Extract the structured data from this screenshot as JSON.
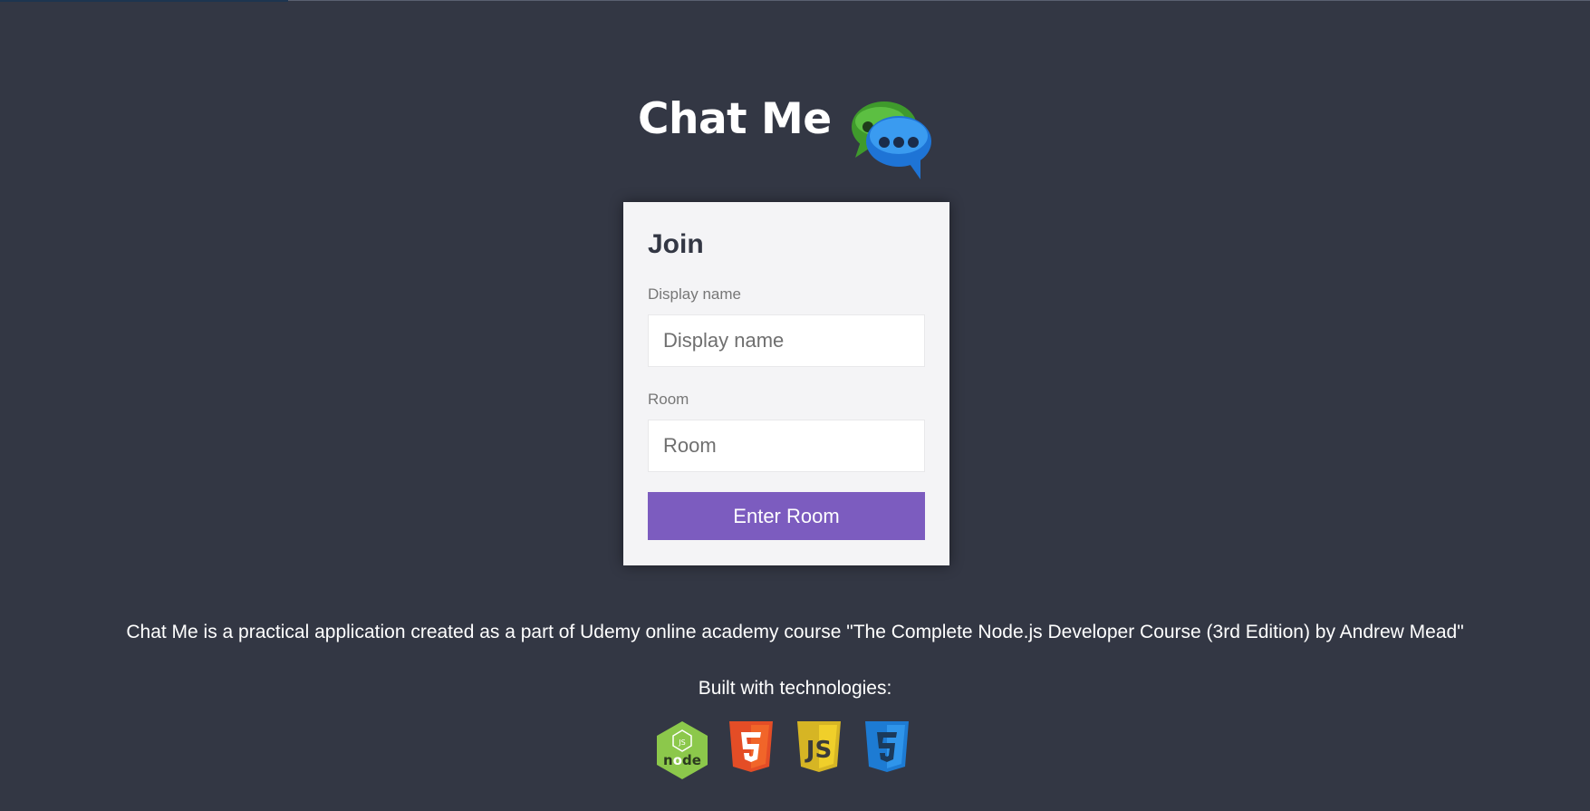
{
  "header": {
    "title": "Chat Me",
    "logo_icon": "chat-bubbles-icon",
    "logo_colors": {
      "back_bubble": "#3f9a2c",
      "front_bubble": "#2d8fe8"
    }
  },
  "join_form": {
    "title": "Join",
    "display_name_label": "Display name",
    "display_name_placeholder": "Display name",
    "display_name_value": "",
    "room_label": "Room",
    "room_placeholder": "Room",
    "room_value": "",
    "submit_label": "Enter Room"
  },
  "footer": {
    "about_text": "Chat Me is a practical application created as a part of Udemy online academy course \"The Complete Node.js Developer Course (3rd Edition) by Andrew Mead\"",
    "built_with_label": "Built with technologies:",
    "technologies": [
      {
        "name": "node",
        "icon": "nodejs-icon",
        "color": "#8cc84b"
      },
      {
        "name": "HTML5",
        "icon": "html5-icon",
        "color": "#e44d26"
      },
      {
        "name": "JS",
        "icon": "javascript-icon",
        "color": "#d6b524"
      },
      {
        "name": "CSS3",
        "icon": "css3-icon",
        "color": "#1d7bd3"
      }
    ]
  },
  "colors": {
    "background": "#333744",
    "card_background": "#f4f4f6",
    "accent_button": "#7c5cbf",
    "text_dark": "#333744",
    "label_grey": "#777777"
  }
}
